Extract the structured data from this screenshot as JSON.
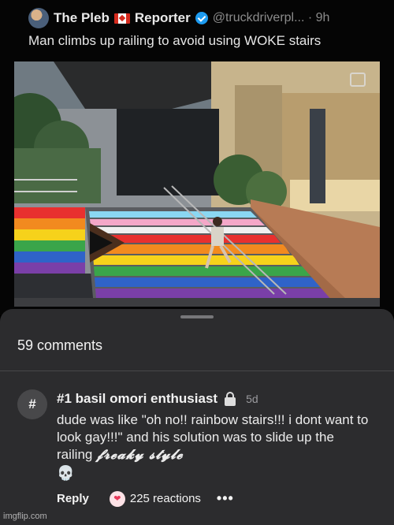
{
  "tweet": {
    "author_name": "The Pleb",
    "author_name_suffix": "Reporter",
    "handle_time": "@truckdriverpl... · 9h",
    "text": "Man climbs up railing to avoid using WOKE stairs",
    "avatar_icon": "profile-avatar",
    "flag_icon": "canada-flag-icon",
    "verified_icon": "verified-badge-icon"
  },
  "sheet": {
    "comments_count": "59 comments"
  },
  "comment": {
    "avatar_text": "#",
    "author": "#1 basil omori enthusiast",
    "time": "5d",
    "body_line1": "dude was like \"oh no!! rainbow stairs!!! i dont want to look gay!!!\" and his solution was to slide up the railing ",
    "body_styled": "𝓯𝓻𝓮𝓪𝓴𝔂 𝓼𝓽𝔂𝓵𝓮",
    "body_emoji": "💀",
    "reply_label": "Reply",
    "reactions_label": "225 reactions",
    "reaction_emoji": "❤",
    "more_label": "•••"
  },
  "watermark": "imgflip.com",
  "colors": {
    "sheet_bg": "#2c2c2e",
    "verified_blue": "#1d9bf0",
    "rainbow": [
      "#e8302f",
      "#f28a1f",
      "#f6d21b",
      "#3aa54a",
      "#2f63c8",
      "#7a3fa8"
    ]
  }
}
